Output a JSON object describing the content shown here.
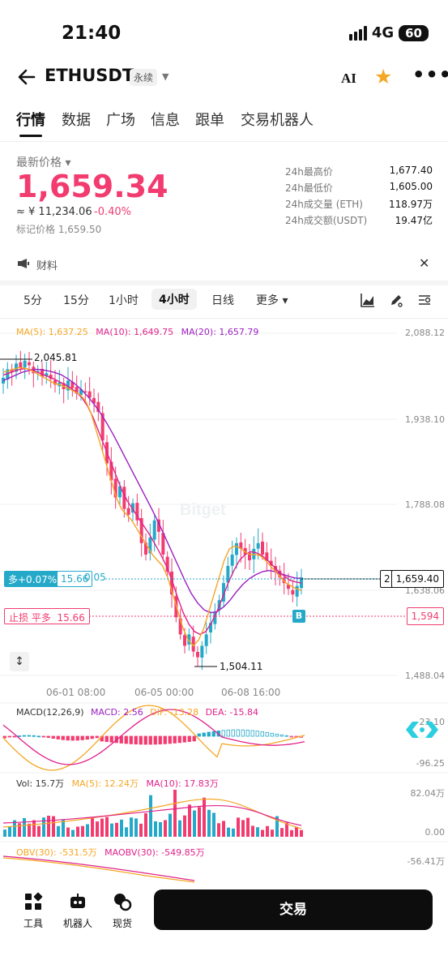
{
  "status_bar": {
    "time": "21:40",
    "network": "4G",
    "battery": "60"
  },
  "header": {
    "symbol": "ETHUSDT",
    "contract_tag": "永续",
    "ai_label": "AI",
    "icons": [
      "back-arrow-icon",
      "caret-down-icon",
      "ai-icon",
      "star-icon",
      "more-icon"
    ],
    "star_color": "#f5a623"
  },
  "main_tabs": [
    "行情",
    "数据",
    "广场",
    "信息",
    "跟单",
    "交易机器人"
  ],
  "price": {
    "label": "最新价格",
    "last": "1,659.34",
    "cny": "≈ ¥ 11,234.06",
    "change": "-0.40%",
    "mark": "标记价格 1,659.50",
    "color": "#f23c70"
  },
  "stats": [
    {
      "label": "24h最高价",
      "value": "1,677.40"
    },
    {
      "label": "24h最低价",
      "value": "1,605.00"
    },
    {
      "label": "24h成交量 (ETH)",
      "value": "118.97万"
    },
    {
      "label": "24h成交额(USDT)",
      "value": "19.47亿"
    }
  ],
  "news": {
    "label": "财料"
  },
  "intervals": {
    "items": [
      "5分",
      "15分",
      "1小时",
      "4小时",
      "日线",
      "更多"
    ],
    "active": "4小时"
  },
  "ma_legend": {
    "ma5": "MA(5): 1,637.25",
    "ma10": "MA(10): 1,649.75",
    "ma20": "MA(20): 1,657.79",
    "colors": {
      "ma5": "#f5a623",
      "ma10": "#e0218a",
      "ma20": "#9b1fbf"
    }
  },
  "watermark": "Bitget",
  "chart_data": {
    "type": "candlestick",
    "price_axis": [
      "2,088.12",
      "1,938.10",
      "1,788.08",
      "1,638.06",
      "1,488.04"
    ],
    "time_axis": [
      "06-01 08:00",
      "06-05 00:00",
      "06-08 16:00"
    ],
    "high_marker": "2,045.81",
    "low_marker": "1,504.11",
    "current_price": "1,659.40",
    "current_price_index": "2",
    "stop_loss_price": "1,594",
    "long_position": {
      "label": "多+0.07%",
      "value": "15.66",
      "entry": "0.05"
    },
    "stop_loss": {
      "label": "止损 平多",
      "value": "15.66"
    },
    "buy_marker": "B",
    "close_path": [
      2010,
      2025,
      2020,
      2035,
      2028,
      2040,
      2032,
      2018,
      2022,
      2012,
      2018,
      2008,
      1998,
      2002,
      1990,
      2005,
      1992,
      1982,
      1990,
      1985,
      1975,
      1965,
      1950,
      1900,
      1860,
      1830,
      1800,
      1820,
      1780,
      1770,
      1790,
      1760,
      1720,
      1700,
      1730,
      1760,
      1740,
      1700,
      1670,
      1630,
      1590,
      1560,
      1540,
      1560,
      1530,
      1520,
      1540,
      1560,
      1580,
      1600,
      1620,
      1650,
      1680,
      1700,
      1720,
      1710,
      1700,
      1690,
      1710,
      1720,
      1700,
      1690,
      1680,
      1670,
      1660,
      1650,
      1640,
      1630,
      1645,
      1660
    ],
    "ma5_path": [
      2020,
      2022,
      2025,
      2028,
      2027,
      2025,
      2020,
      2015,
      2010,
      2005,
      2000,
      1998,
      1994,
      1990,
      1985,
      1980,
      1970,
      1950,
      1920,
      1890,
      1860,
      1830,
      1800,
      1780,
      1770,
      1760,
      1745,
      1730,
      1715,
      1700,
      1690,
      1680,
      1660,
      1630,
      1600,
      1570,
      1550,
      1540,
      1550,
      1570,
      1600,
      1630,
      1660,
      1690,
      1710,
      1715,
      1712,
      1705,
      1700,
      1700,
      1698,
      1690,
      1680,
      1670,
      1660,
      1650,
      1645,
      1640,
      1637
    ],
    "ma10_path": [
      2015,
      2018,
      2022,
      2025,
      2026,
      2024,
      2020,
      2016,
      2012,
      2008,
      2003,
      1998,
      1992,
      1985,
      1975,
      1960,
      1940,
      1915,
      1890,
      1865,
      1840,
      1815,
      1795,
      1780,
      1765,
      1750,
      1735,
      1718,
      1700,
      1680,
      1655,
      1625,
      1598,
      1578,
      1565,
      1560,
      1565,
      1580,
      1600,
      1625,
      1650,
      1672,
      1690,
      1700,
      1705,
      1703,
      1698,
      1690,
      1680,
      1670,
      1662,
      1655,
      1652,
      1650
    ],
    "ma20_path": [
      2005,
      2010,
      2015,
      2020,
      2023,
      2025,
      2024,
      2022,
      2019,
      2015,
      2008,
      2000,
      1990,
      1978,
      1964,
      1948,
      1930,
      1910,
      1888,
      1866,
      1844,
      1822,
      1800,
      1778,
      1755,
      1730,
      1705,
      1680,
      1655,
      1632,
      1615,
      1603,
      1598,
      1600,
      1608,
      1620,
      1635,
      1648,
      1658,
      1665,
      1670,
      1672,
      1670,
      1666,
      1662,
      1659,
      1658
    ],
    "ylim": [
      1488.04,
      2088.12
    ]
  },
  "macd": {
    "params": "MACD(12,26,9)",
    "macd": "MACD: 2.56",
    "dif": "DIF: -13.28",
    "dea": "DEA: -15.84",
    "axis_top": "23.10",
    "axis_bottom": "-96.25",
    "colors": {
      "macd": "#9b1fbf",
      "dif": "#f5a623",
      "dea": "#e0218a"
    }
  },
  "volume": {
    "vol": "Vol: 15.7万",
    "ma5": "MA(5): 12.24万",
    "ma10": "MA(10): 17.83万",
    "axis_top": "82.04万",
    "axis_bottom": "0.00"
  },
  "obv": {
    "obv": "OBV(30): -531.5万",
    "maobv": "MAOBV(30): -549.85万",
    "axis": "-56.41万"
  },
  "bottom_bar": {
    "items": [
      {
        "label": "工具",
        "icon": "tools-icon"
      },
      {
        "label": "机器人",
        "icon": "robot-icon"
      },
      {
        "label": "现货",
        "icon": "spot-icon"
      }
    ],
    "trade_button": "交易"
  }
}
